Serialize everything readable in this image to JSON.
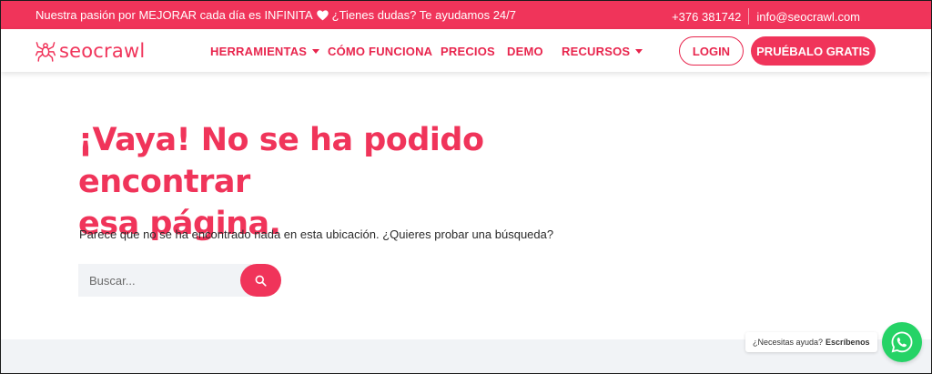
{
  "topbar": {
    "promo_text": "Nuestra pasión por MEJORAR cada día es INFINITA",
    "promo_question": "¿Tienes dudas? Te ayudamos 24/7",
    "phone": "+376 381742",
    "email": "info@seocrawl.com"
  },
  "brand": {
    "name": "seocrawl",
    "color": "#f0345a"
  },
  "nav": {
    "items": [
      {
        "label": "HERRAMIENTAS",
        "dropdown": true
      },
      {
        "label": "CÓMO FUNCIONA",
        "dropdown": false
      },
      {
        "label": "PRECIOS",
        "dropdown": false
      },
      {
        "label": "DEMO",
        "dropdown": false
      },
      {
        "label": "RECURSOS",
        "dropdown": true
      }
    ],
    "login_label": "LOGIN",
    "try_label": "PRUÉBALO GRATIS"
  },
  "main": {
    "title_line1": "¡Vaya! No se ha podido encontrar",
    "title_line2": "esa página.",
    "message": "Parece que no se ha encontrado nada en esta ubicación. ¿Quieres probar una búsqueda?",
    "search_placeholder": "Buscar..."
  },
  "whatsapp": {
    "prompt": "¿Necesitas ayuda?",
    "action": "Escríbenos",
    "color": "#25d366"
  }
}
